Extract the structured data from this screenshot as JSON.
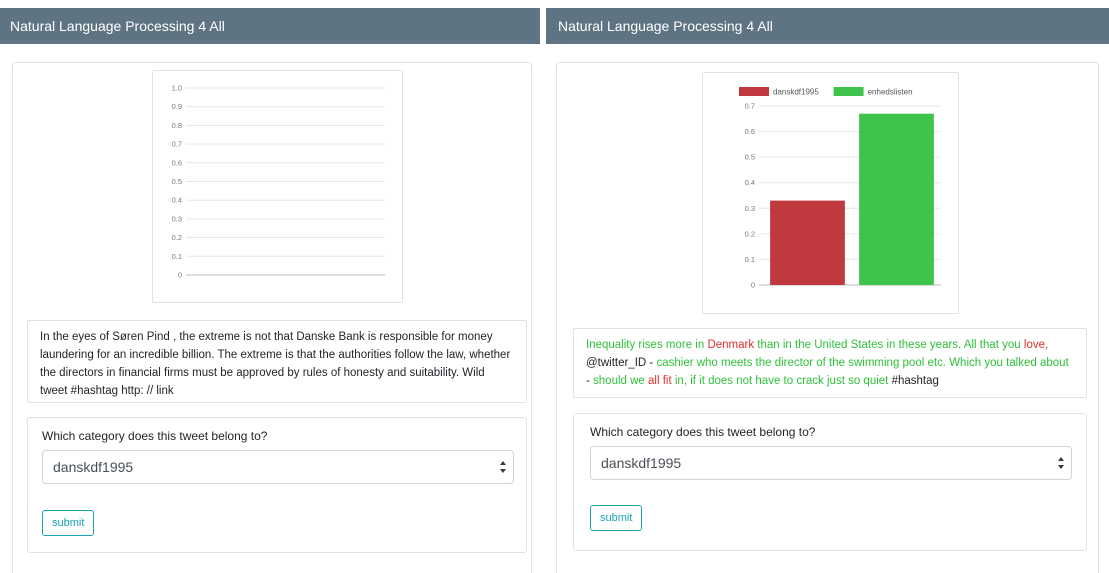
{
  "left": {
    "navbar_title": "Natural Language Processing 4 All",
    "tweet_text": "In the eyes of Søren Pind , the extreme is not that Danske Bank is responsible for money laundering for an incredible billion. The extreme is that the authorities follow the law, whether the directors in financial firms must be approved by rules of honesty and suitability. Wild tweet #hashtag http: // link",
    "question": "Which category does this tweet belong to?",
    "select_value": "danskdf1995",
    "submit_label": "submit",
    "chart_data": {
      "type": "bar",
      "categories": [],
      "series": [],
      "ylim": [
        0,
        1.0
      ],
      "yticks": [
        "1.0",
        "0.9",
        "0.8",
        "0.7",
        "0.6",
        "0.5",
        "0.4",
        "0.3",
        "0.2",
        "0.1",
        "0"
      ],
      "grid": true
    }
  },
  "right": {
    "navbar_title": "Natural Language Processing 4 All",
    "tweet_segments": [
      {
        "text": "Inequality rises more in ",
        "color": "green"
      },
      {
        "text": "Denmark",
        "color": "red"
      },
      {
        "text": " than in the United States in these years. All that you ",
        "color": "green"
      },
      {
        "text": "love,",
        "color": "red"
      },
      {
        "text": " @twitter_ID - ",
        "color": "black"
      },
      {
        "text": "cashier who meets the director of the swimming pool etc. Which you talked about",
        "color": "green"
      },
      {
        "text": " - ",
        "color": "black"
      },
      {
        "text": "should we ",
        "color": "green"
      },
      {
        "text": "all fit",
        "color": "red"
      },
      {
        "text": " in, if it does not have to crack just so quiet",
        "color": "green"
      },
      {
        "text": " #hashtag",
        "color": "black"
      }
    ],
    "question": "Which category does this tweet belong to?",
    "select_value": "danskdf1995",
    "submit_label": "submit",
    "chart_data": {
      "type": "bar",
      "categories": [
        "danskdf1995",
        "enhedslisten"
      ],
      "series": [
        {
          "name": "danskdf1995",
          "values": [
            0.33
          ],
          "color": "#c0393f"
        },
        {
          "name": "enhedslisten",
          "values": [
            0.67
          ],
          "color": "#3ec44b"
        }
      ],
      "ylim": [
        0,
        0.7
      ],
      "yticks": [
        "0.7",
        "0.6",
        "0.5",
        "0.4",
        "0.3",
        "0.2",
        "0.1",
        "0"
      ],
      "legend_position": "top",
      "grid": true
    }
  },
  "colors": {
    "navbar": "#5f7483",
    "text_green": "#2fc13b",
    "text_red": "#e0302a",
    "button": "#17a2b8"
  }
}
